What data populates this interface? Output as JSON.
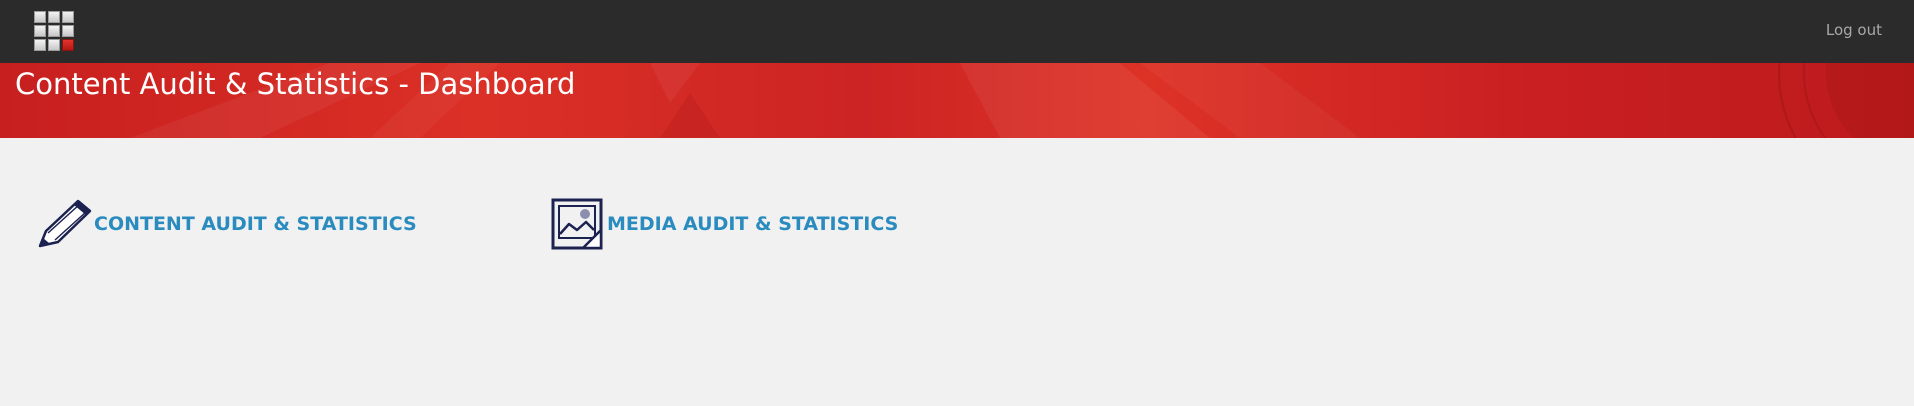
{
  "topbar": {
    "launcher_icon": "app-grid-icon",
    "logout_label": "Log out"
  },
  "banner": {
    "title": "Content Audit & Statistics - Dashboard"
  },
  "tiles": [
    {
      "icon": "pencil-icon",
      "label": "CONTENT AUDIT & STATISTICS"
    },
    {
      "icon": "image-icon",
      "label": "MEDIA AUDIT & STATISTICS"
    }
  ],
  "colors": {
    "topbar_bg": "#2b2b2b",
    "banner_red": "#cc2424",
    "link_blue": "#2a8bbf",
    "icon_navy": "#1c2250",
    "page_bg": "#f1f1f1"
  }
}
